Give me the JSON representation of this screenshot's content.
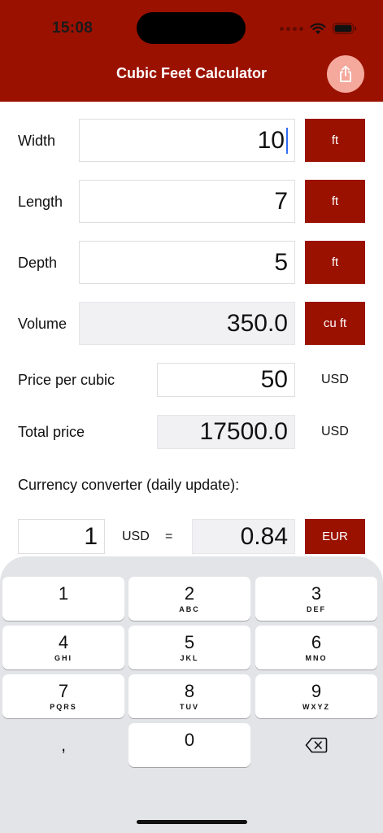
{
  "status_bar": {
    "time": "15:08"
  },
  "header": {
    "title": "Cubic Feet Calculator",
    "share_icon": "share-icon"
  },
  "form": {
    "width": {
      "label": "Width",
      "value": "10",
      "unit": "ft"
    },
    "length": {
      "label": "Length",
      "value": "7",
      "unit": "ft"
    },
    "depth": {
      "label": "Depth",
      "value": "5",
      "unit": "ft"
    },
    "volume": {
      "label": "Volume",
      "value": "350.0",
      "unit": "cu ft"
    },
    "price_per_cubic": {
      "label": "Price per cubic",
      "value": "50",
      "currency": "USD"
    },
    "total_price": {
      "label": "Total price",
      "value": "17500.0",
      "currency": "USD"
    }
  },
  "converter": {
    "heading": "Currency converter (daily update):",
    "amount": "1",
    "from_currency": "USD",
    "equals": "=",
    "result": "0.84",
    "to_currency": "EUR"
  },
  "keyboard": {
    "keys": [
      {
        "digit": "1",
        "letters": ""
      },
      {
        "digit": "2",
        "letters": "ABC"
      },
      {
        "digit": "3",
        "letters": "DEF"
      },
      {
        "digit": "4",
        "letters": "GHI"
      },
      {
        "digit": "5",
        "letters": "JKL"
      },
      {
        "digit": "6",
        "letters": "MNO"
      },
      {
        "digit": "7",
        "letters": "PQRS"
      },
      {
        "digit": "8",
        "letters": "TUV"
      },
      {
        "digit": "9",
        "letters": "WXYZ"
      },
      {
        "digit": ",",
        "letters": ""
      },
      {
        "digit": "0",
        "letters": ""
      }
    ],
    "delete_icon": "delete-backspace-icon"
  },
  "colors": {
    "accent": "#9b1100",
    "share_button": "#f4a99c",
    "keyboard_bg": "#e3e4e8",
    "caret": "#2f6cf6"
  }
}
